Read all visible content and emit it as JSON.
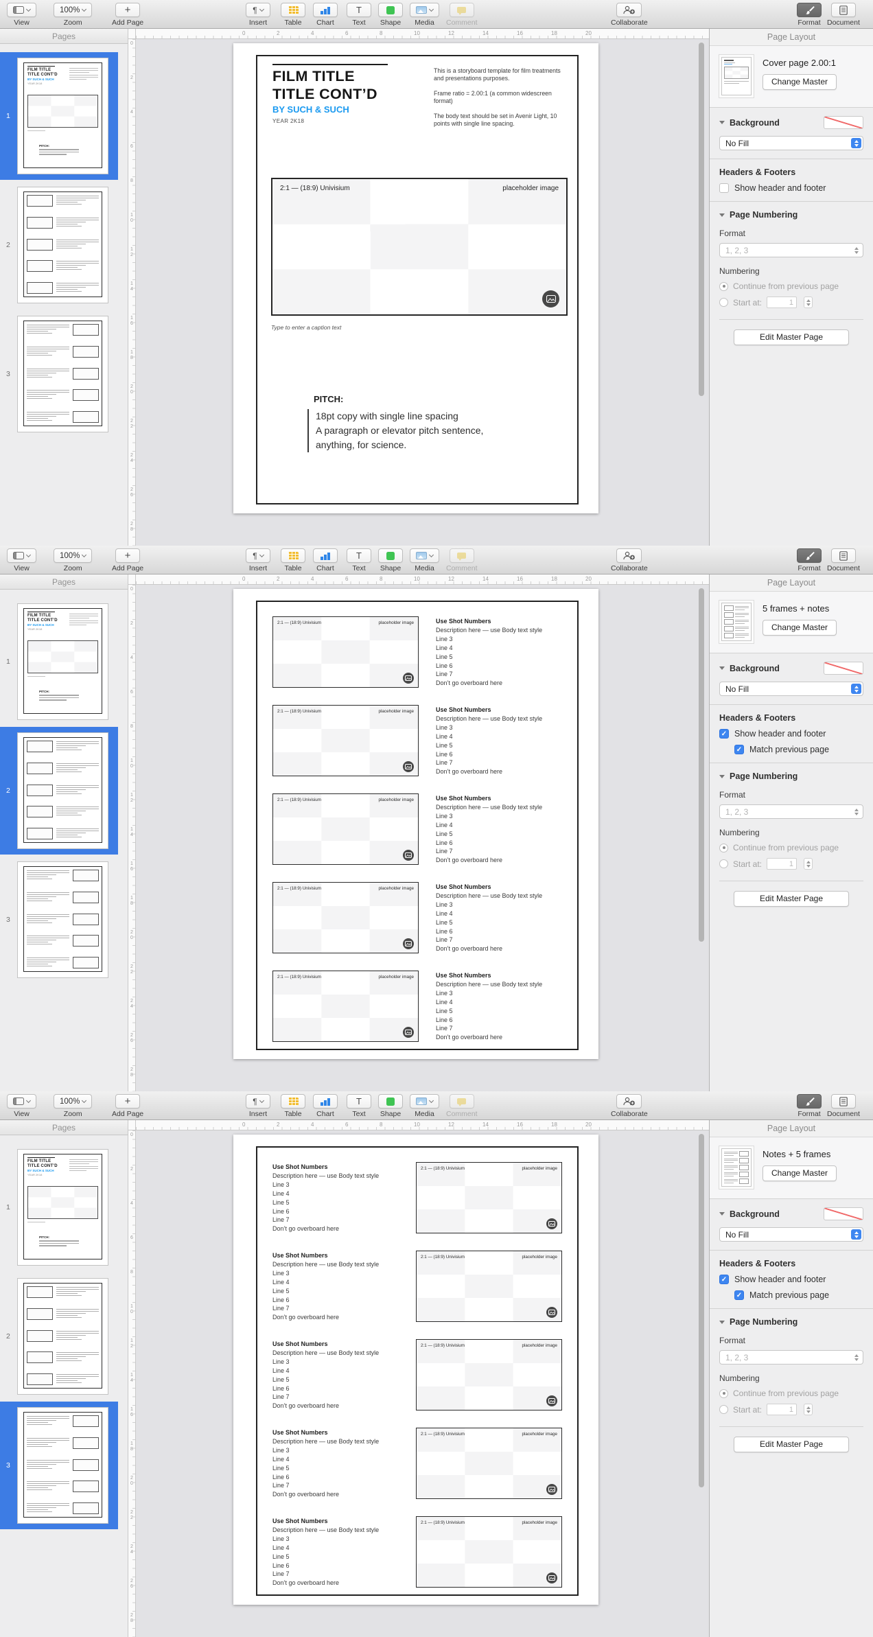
{
  "ui": {
    "toolbar": {
      "view": "View",
      "zoom": "Zoom",
      "zoom_value": "100%",
      "add_page": "Add Page",
      "insert": "Insert",
      "table": "Table",
      "chart": "Chart",
      "text": "Text",
      "shape": "Shape",
      "media": "Media",
      "comment": "Comment",
      "collaborate": "Collaborate",
      "format": "Format",
      "document": "Document"
    },
    "sidebar_title": "Pages",
    "inspector": {
      "title": "Page Layout",
      "change_master": "Change Master",
      "background": "Background",
      "no_fill": "No Fill",
      "headers_footers": "Headers & Footers",
      "show_header": "Show header and footer",
      "match_previous": "Match previous page",
      "page_numbering": "Page Numbering",
      "format_label": "Format",
      "format_value": "1, 2, 3",
      "numbering": "Numbering",
      "continue_radio": "Continue from previous page",
      "start_at": "Start at:",
      "start_value": "1",
      "edit_master": "Edit Master Page"
    },
    "rulers": {
      "horizontal": [
        "0",
        "2",
        "4",
        "6",
        "8",
        "10",
        "12",
        "14",
        "16",
        "18",
        "20"
      ],
      "vertical": [
        "0",
        "2",
        "4",
        "6",
        "8",
        "10",
        "12",
        "14",
        "16",
        "18",
        "20",
        "22",
        "24",
        "26",
        "28"
      ]
    },
    "page_numbers": [
      "1",
      "2",
      "3"
    ]
  },
  "cover": {
    "title1": "FILM TITLE",
    "title2": "TITLE CONT’D",
    "byline": "BY SUCH & SUCH",
    "year": "YEAR 2K18",
    "p1": "This is a storyboard template for film treatments and presentations purposes.",
    "p2": "Frame ratio = 2.00:1 (a common widescreen format)",
    "p3": "The body text should be set in Avenir Light, 10 points with single line spacing.",
    "caption": "Type to enter a caption text",
    "pitch_heading": "PITCH:",
    "pitch_lines": [
      "18pt copy with single line spacing",
      "A paragraph or elevator pitch sentence,",
      "anything, for science."
    ]
  },
  "frame": {
    "label_left": "2:1 — (18:9) Univisium",
    "label_right": "placeholder image"
  },
  "notes": {
    "title": "Use Shot Numbers",
    "lines": [
      "Description here — use Body text style",
      "Line 3",
      "Line 4",
      "Line 5",
      "Line 6",
      "Line 7",
      "Don’t go overboard here"
    ]
  },
  "strips": [
    {
      "master_name": "Cover page 2.00:1",
      "selected_page": 1,
      "show_header": false,
      "match_previous": null,
      "variant": "cover"
    },
    {
      "master_name": "5 frames + notes",
      "selected_page": 2,
      "show_header": true,
      "match_previous": true,
      "variant": "frames-left"
    },
    {
      "master_name": "Notes + 5 frames",
      "selected_page": 3,
      "show_header": true,
      "match_previous": true,
      "variant": "frames-right"
    }
  ],
  "colors": {
    "accent_blue": "#3e86f0",
    "selection_blue": "#3d7ce4",
    "byline_blue": "#1b9af0",
    "no_fill_red": "#f06a6a"
  }
}
